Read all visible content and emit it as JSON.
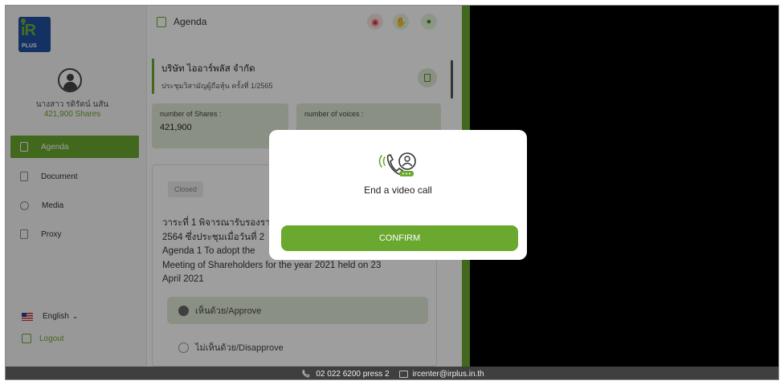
{
  "app": {
    "logo_text": "iR",
    "logo_sub": "PLUS"
  },
  "user": {
    "name": "นางสาว รติรัตน์ นสัน",
    "shares": "421,900 Shares"
  },
  "nav": {
    "items": [
      {
        "label": "Agenda",
        "icon": "agenda-icon",
        "active": true
      },
      {
        "label": "Document",
        "icon": "document-icon",
        "active": false
      },
      {
        "label": "Media",
        "icon": "media-icon",
        "active": false
      },
      {
        "label": "Proxy",
        "icon": "proxy-icon",
        "active": false
      }
    ],
    "language": "English",
    "logout": "Logout"
  },
  "header": {
    "title": "Agenda"
  },
  "company": {
    "name": "บริษัท ไออาร์พลัส จำกัด",
    "meeting": "ประชุมวิสามัญผู้ถือหุ้น ครั้งที่ 1/2565"
  },
  "cards": {
    "shares_label": "number of Shares :",
    "shares_value": "421,900",
    "voices_label": "number of voices :"
  },
  "agenda": {
    "status": "Closed",
    "text_lines": [
      "วาระที่ 1 พิจารณารับรองรา",
      "2564 ซึ่งประชุมเมื่อวันที่ 2",
      "Agenda 1 To adopt the",
      "Meeting of Shareholders for the year 2021 held on 23",
      "April 2021"
    ],
    "options": [
      {
        "label": "เห็นด้วย/Approve",
        "selected": true
      },
      {
        "label": "ไม่เห็นด้วย/Disapprove",
        "selected": false
      }
    ]
  },
  "modal": {
    "title": "End a video call",
    "confirm": "CONFIRM"
  },
  "footer": {
    "phone": "02 022 6200 press 2",
    "email": "ircenter@irplus.in.th"
  },
  "colors": {
    "accent": "#6aa82f",
    "card_bg": "#e0e9d6",
    "footer_bg": "#3f3f3f"
  }
}
